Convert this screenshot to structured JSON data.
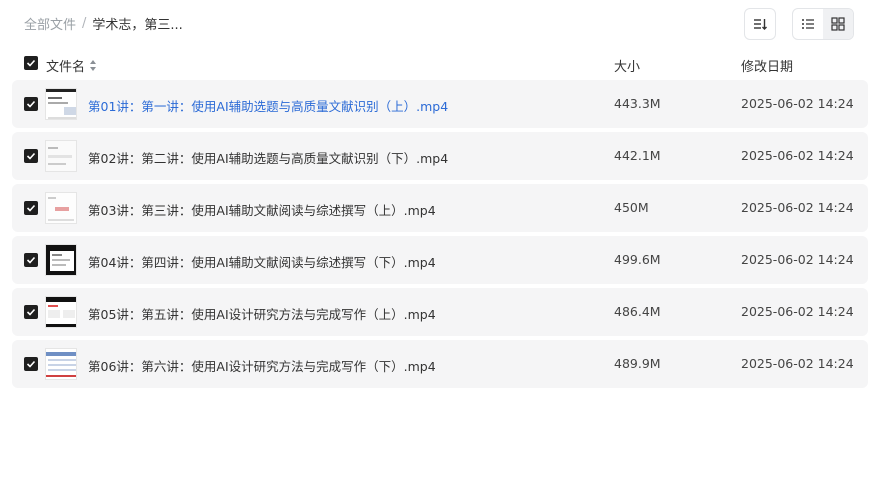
{
  "breadcrumb": {
    "root": "全部文件",
    "separator": "/",
    "current": "学术志，第三..."
  },
  "toolbar": {
    "sort_icon": "sort-lines-icon",
    "list_view_icon": "list-view-icon",
    "grid_view_icon": "grid-view-icon",
    "active_view": "list"
  },
  "table": {
    "columns": {
      "name": "文件名",
      "size": "大小",
      "date": "修改日期"
    },
    "rows": [
      {
        "name": "第01讲：第一讲：使用AI辅助选题与高质量文献识别（上）.mp4",
        "size": "443.3M",
        "date": "2025-06-02 14:24",
        "thumb": "a"
      },
      {
        "name": "第02讲：第二讲：使用AI辅助选题与高质量文献识别（下）.mp4",
        "size": "442.1M",
        "date": "2025-06-02 14:24",
        "thumb": "b"
      },
      {
        "name": "第03讲：第三讲：使用AI辅助文献阅读与综述撰写（上）.mp4",
        "size": "450M",
        "date": "2025-06-02 14:24",
        "thumb": "c"
      },
      {
        "name": "第04讲：第四讲：使用AI辅助文献阅读与综述撰写（下）.mp4",
        "size": "499.6M",
        "date": "2025-06-02 14:24",
        "thumb": "d"
      },
      {
        "name": "第05讲：第五讲：使用AI设计研究方法与完成写作（上）.mp4",
        "size": "486.4M",
        "date": "2025-06-02 14:24",
        "thumb": "e"
      },
      {
        "name": "第06讲：第六讲：使用AI设计研究方法与完成写作（下）.mp4",
        "size": "489.9M",
        "date": "2025-06-02 14:24",
        "thumb": "f"
      }
    ]
  },
  "colors": {
    "link": "#2c6bd6",
    "row_bg": "#f5f5f6",
    "checkbox": "#1f1f1f"
  }
}
